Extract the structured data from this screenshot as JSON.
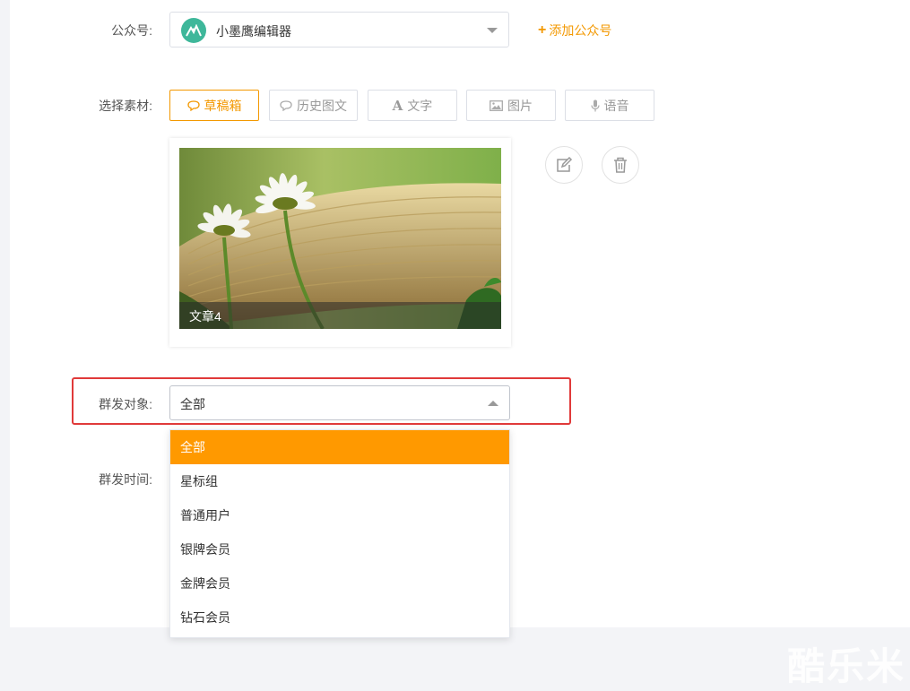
{
  "form": {
    "account_label": "公众号:",
    "account_value": "小墨鹰编辑器",
    "add_account": "添加公众号",
    "material_label": "选择素材:",
    "tabs": [
      {
        "label": "草稿箱",
        "icon": "chat-bubble-icon",
        "active": true
      },
      {
        "label": "历史图文",
        "icon": "chat-bubble-icon",
        "active": false
      },
      {
        "label": "文字",
        "icon": "text-a-icon",
        "active": false
      },
      {
        "label": "图片",
        "icon": "image-icon",
        "active": false
      },
      {
        "label": "语音",
        "icon": "microphone-icon",
        "active": false
      }
    ],
    "article_title": "文章4",
    "target_label": "群发对象:",
    "target_value": "全部",
    "time_label": "群发时间:",
    "target_options": [
      "全部",
      "星标组",
      "普通用户",
      "银牌会员",
      "金牌会员",
      "钻石会员"
    ]
  },
  "watermark": "酷乐米",
  "colors": {
    "accent": "#f39800",
    "selected_option_bg": "#ff9900",
    "highlight_border": "#e03a3a"
  }
}
